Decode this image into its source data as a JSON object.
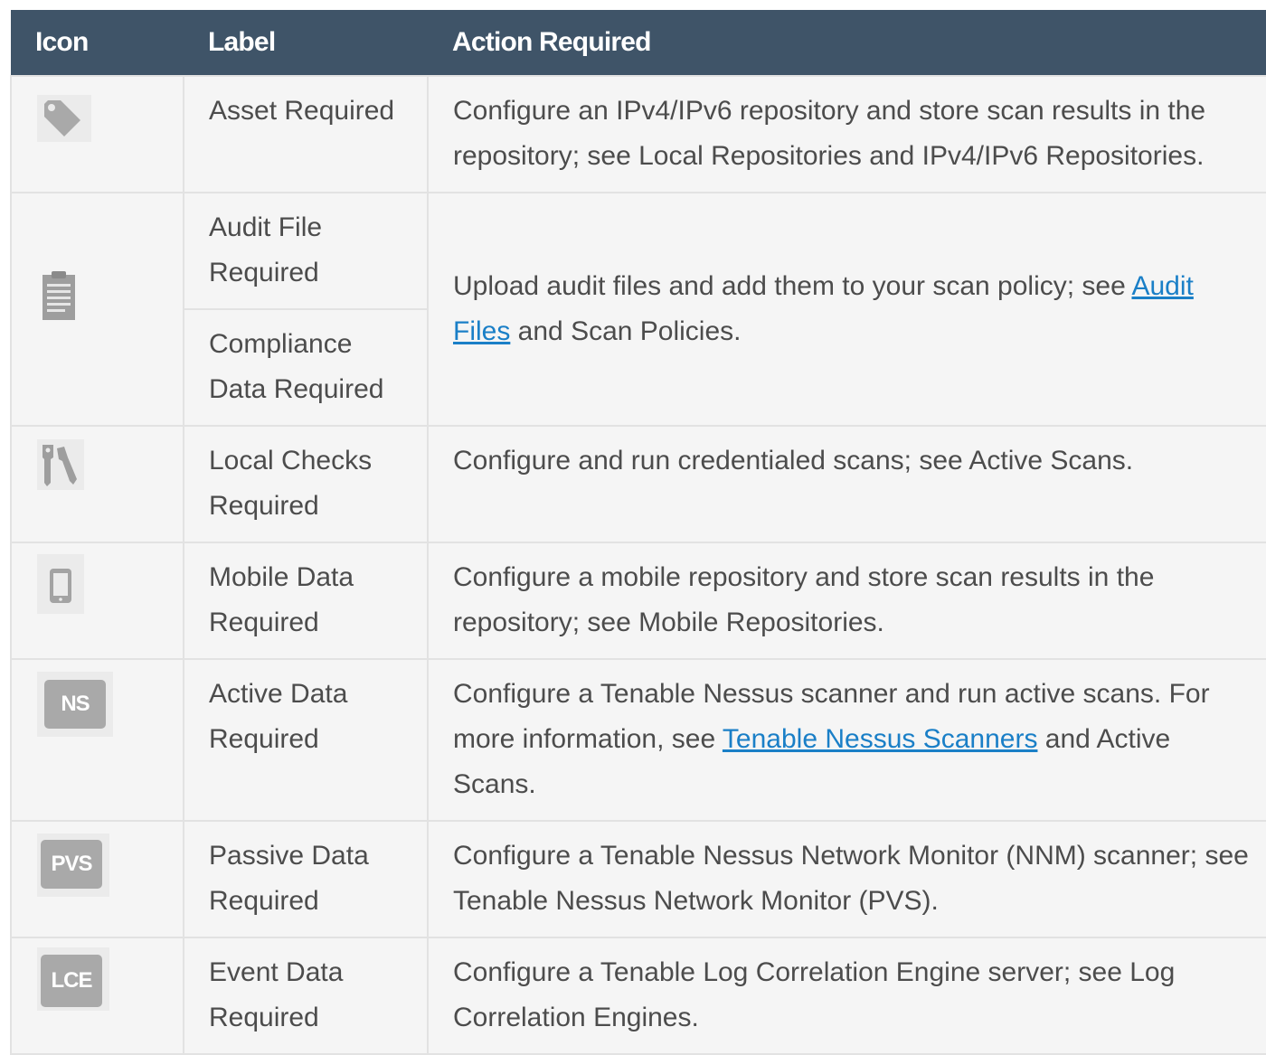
{
  "header": {
    "icon": "Icon",
    "label": "Label",
    "action": "Action Required"
  },
  "rows": [
    {
      "icon": "tag-icon",
      "label": "Asset Required",
      "action": "Configure an IPv4/IPv6 repository and store scan results in the repository; see Local Repositories and IPv4/IPv6 Repositories."
    },
    {
      "icon": "clipboard-icon",
      "label": "Audit File Required",
      "label2": "Compliance Data Required",
      "action_pre": "Upload audit files and add them to your scan policy; see ",
      "action_link": "Audit Files",
      "action_post": " and Scan Policies."
    },
    {
      "icon": "keys-icon",
      "label": "Local Checks Required",
      "action": "Configure and run credentialed scans; see Active Scans."
    },
    {
      "icon": "mobile-icon",
      "label": "Mobile Data Required",
      "action": "Configure a mobile repository and store scan results in the repository; see Mobile Repositories."
    },
    {
      "icon": "NS",
      "label": "Active Data Required",
      "action_pre": "Configure a Tenable Nessus scanner and run active scans. For more information, see ",
      "action_link": "Tenable Nessus Scanners",
      "action_post": " and Active Scans."
    },
    {
      "icon": "PVS",
      "label": "Passive Data Required",
      "action": "Configure a Tenable Nessus Network Monitor (NNM) scanner; see Tenable Nessus Network Monitor (PVS)."
    },
    {
      "icon": "LCE",
      "label": "Event Data Required",
      "action": "Configure a Tenable Log Correlation Engine server; see Log Correlation Engines."
    }
  ],
  "colors": {
    "header_bg": "#3f5468",
    "row_bg": "#f5f5f5",
    "link": "#1a7fc7",
    "icon_gray": "#a9a9a9"
  }
}
